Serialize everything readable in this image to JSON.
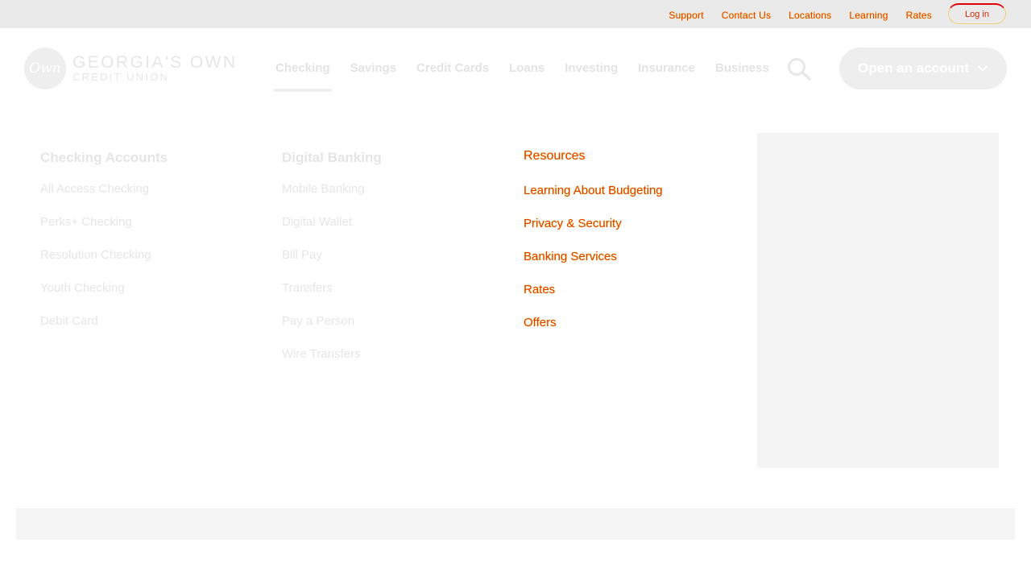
{
  "utility": {
    "links": [
      "Support",
      "Contact Us",
      "Locations",
      "Learning",
      "Rates"
    ],
    "login_label": "Log in"
  },
  "logo": {
    "badge_text": "Own",
    "line1": "GEORGIA'S OWN",
    "line2": "CREDIT UNION"
  },
  "nav": {
    "items": [
      "Checking",
      "Savings",
      "Credit Cards",
      "Loans",
      "Investing",
      "Insurance",
      "Business"
    ],
    "active": "Checking"
  },
  "cta": {
    "open_account_label": "Open an account"
  },
  "menu": {
    "checking": {
      "heading": "Checking Accounts",
      "links": [
        "All Access Checking",
        "Perks+ Checking",
        "Resolution Checking",
        "Youth Checking",
        "Debit Card"
      ]
    },
    "digital": {
      "heading": "Digital Banking",
      "links": [
        "Mobile Banking",
        "Digital Wallet",
        "Bill Pay",
        "Transfers",
        "Pay a Person",
        "Wire Transfers"
      ]
    },
    "resources": {
      "heading": "Resources",
      "links": [
        "Learning About Budgeting",
        "Privacy & Security",
        "Banking Services",
        "Rates",
        "Offers"
      ]
    }
  },
  "colors": {
    "utility_bg": "#eaeaea",
    "accent_text": "#e23b00",
    "accent_glow": "#ffd800",
    "faded": "#e6e6e6"
  },
  "icons": [
    "search-icon",
    "chevron-down-icon",
    "logo-badge"
  ]
}
